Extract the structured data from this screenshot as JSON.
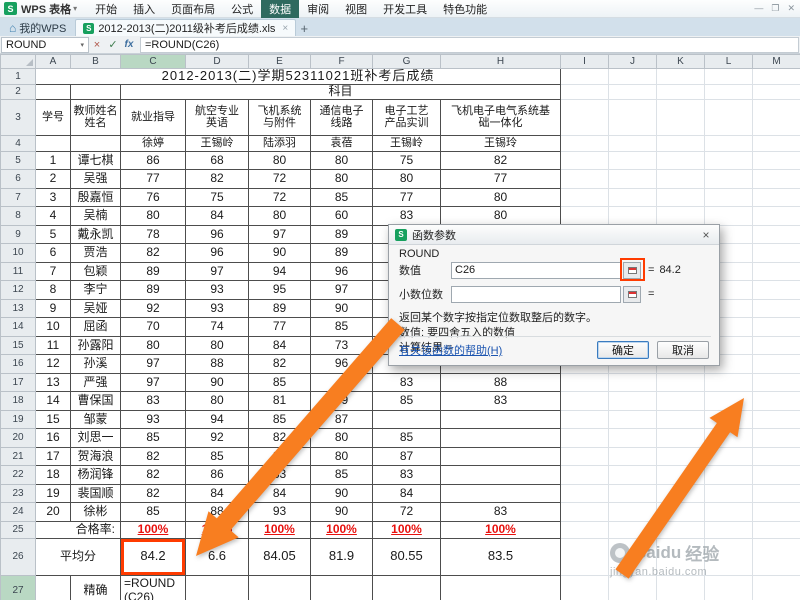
{
  "colors": {
    "arrow_orange": "#f87e20",
    "annotation_red": "#ff3b00",
    "pass_red": "#e8110e",
    "app_green": "#17a05e",
    "active_tab_bg": "#2f6a5f",
    "header_sel_bg": "#b9d8c3"
  },
  "chrome": {
    "app_logo_letter": "S",
    "app_name": "WPS 表格",
    "dropdown_caret": "▾",
    "menu_tabs": [
      "开始",
      "插入",
      "页面布局",
      "公式",
      "数据",
      "审阅",
      "视图",
      "开发工具",
      "特色功能"
    ],
    "active_menu_tab": "数据",
    "window_buttons": [
      "—",
      "❐",
      "✕"
    ],
    "home_icon": "⌂",
    "home_tab_label": "我的WPS",
    "doc_tab_label": "2012-2013(二)2011级补考后成绩.xls",
    "doc_tab_close": "×",
    "new_tab_button": "+",
    "name_box_value": "ROUND",
    "cancel_glyph": "×",
    "enter_glyph": "✓",
    "fx_glyph": "fx",
    "formula_value": "=ROUND(C26)"
  },
  "sheet": {
    "col_headers": [
      "A",
      "B",
      "C",
      "D",
      "E",
      "F",
      "G",
      "H",
      "I",
      "J",
      "K",
      "L",
      "M"
    ],
    "selected_col": "C",
    "selected_row": 27,
    "title": "2012-2013(二)学期52311021班补考后成绩",
    "band_label": "科目",
    "header_no": "学号",
    "header_name": "教师姓名\n姓名",
    "subjects": [
      "就业指导",
      "航空专业\n英语",
      "飞机系统\n与附件",
      "通信电子\n线路",
      "电子工艺\n产品实训",
      "飞机电子电气系统基\n础一体化"
    ],
    "teachers": [
      "徐婷",
      "王锡岭",
      "陆添羽",
      "袁蓓",
      "王锡岭",
      "王锡玲"
    ],
    "students": [
      {
        "no": "1",
        "name": "谭七棋",
        "scores": [
          "86",
          "68",
          "80",
          "80",
          "75",
          "82"
        ]
      },
      {
        "no": "2",
        "name": "吴强",
        "scores": [
          "77",
          "82",
          "72",
          "80",
          "80",
          "77"
        ]
      },
      {
        "no": "3",
        "name": "殷嘉恒",
        "scores": [
          "76",
          "75",
          "72",
          "85",
          "77",
          "80"
        ]
      },
      {
        "no": "4",
        "name": "吴楠",
        "scores": [
          "80",
          "84",
          "80",
          "60",
          "83",
          "80"
        ]
      },
      {
        "no": "5",
        "name": "戴永凯",
        "scores": [
          "78",
          "96",
          "97",
          "89",
          "",
          ""
        ]
      },
      {
        "no": "6",
        "name": "贾浩",
        "scores": [
          "82",
          "96",
          "90",
          "89",
          "",
          ""
        ]
      },
      {
        "no": "7",
        "name": "包颖",
        "scores": [
          "89",
          "97",
          "94",
          "96",
          "",
          ""
        ]
      },
      {
        "no": "8",
        "name": "李宁",
        "scores": [
          "89",
          "93",
          "95",
          "97",
          "",
          ""
        ]
      },
      {
        "no": "9",
        "name": "吴娅",
        "scores": [
          "92",
          "93",
          "89",
          "90",
          "",
          ""
        ]
      },
      {
        "no": "10",
        "name": "屈函",
        "scores": [
          "70",
          "74",
          "77",
          "85",
          "",
          ""
        ]
      },
      {
        "no": "11",
        "name": "孙露阳",
        "scores": [
          "80",
          "80",
          "84",
          "73",
          "",
          ""
        ]
      },
      {
        "no": "12",
        "name": "孙溪",
        "scores": [
          "97",
          "88",
          "82",
          "96",
          "",
          ""
        ]
      },
      {
        "no": "13",
        "name": "严强",
        "scores": [
          "97",
          "90",
          "85",
          "",
          "83",
          "88"
        ]
      },
      {
        "no": "14",
        "name": "曹保国",
        "scores": [
          "83",
          "80",
          "81",
          "79",
          "85",
          "83"
        ]
      },
      {
        "no": "15",
        "name": "邹蒙",
        "scores": [
          "93",
          "94",
          "85",
          "87",
          "",
          ""
        ]
      },
      {
        "no": "16",
        "name": "刘思一",
        "scores": [
          "85",
          "92",
          "82",
          "80",
          "85",
          ""
        ]
      },
      {
        "no": "17",
        "name": "贺海浪",
        "scores": [
          "82",
          "85",
          "85",
          "80",
          "87",
          ""
        ]
      },
      {
        "no": "18",
        "name": "杨润锋",
        "scores": [
          "82",
          "86",
          "83",
          "85",
          "83",
          ""
        ]
      },
      {
        "no": "19",
        "name": "裴国顺",
        "scores": [
          "82",
          "84",
          "84",
          "90",
          "84",
          ""
        ]
      },
      {
        "no": "20",
        "name": "徐彬",
        "scores": [
          "85",
          "88",
          "93",
          "90",
          "72",
          "83"
        ]
      }
    ],
    "pass_label": "合格率:",
    "pass_rates": [
      "100%",
      "100%",
      "100%",
      "100%",
      "100%",
      "100%"
    ],
    "avg_label": "平均分",
    "averages": [
      "84.2",
      "6.6",
      "84.05",
      "81.9",
      "80.55",
      "83.5"
    ],
    "precise_label": "精确",
    "editing_formula": "=ROUND(C26)"
  },
  "dialog": {
    "title": "函数参数",
    "func": "ROUND",
    "arg1_label": "数值",
    "arg1_value": "C26",
    "arg1_eq": "=",
    "arg1_result": "84.2",
    "arg2_label": "小数位数",
    "arg2_value": "",
    "arg2_eq": "=",
    "desc": "返回某个数字按指定位数取整后的数字。",
    "hint": "数值:  要四舍五入的数值",
    "result_line": "计算结果 =",
    "help_link": "有关该函数的帮助(H)",
    "ok": "确定",
    "cancel": "取消",
    "close": "×"
  },
  "watermark": {
    "brand_en": "Baidu",
    "brand_cn": "经验",
    "url": "jingyan.baidu.com"
  }
}
